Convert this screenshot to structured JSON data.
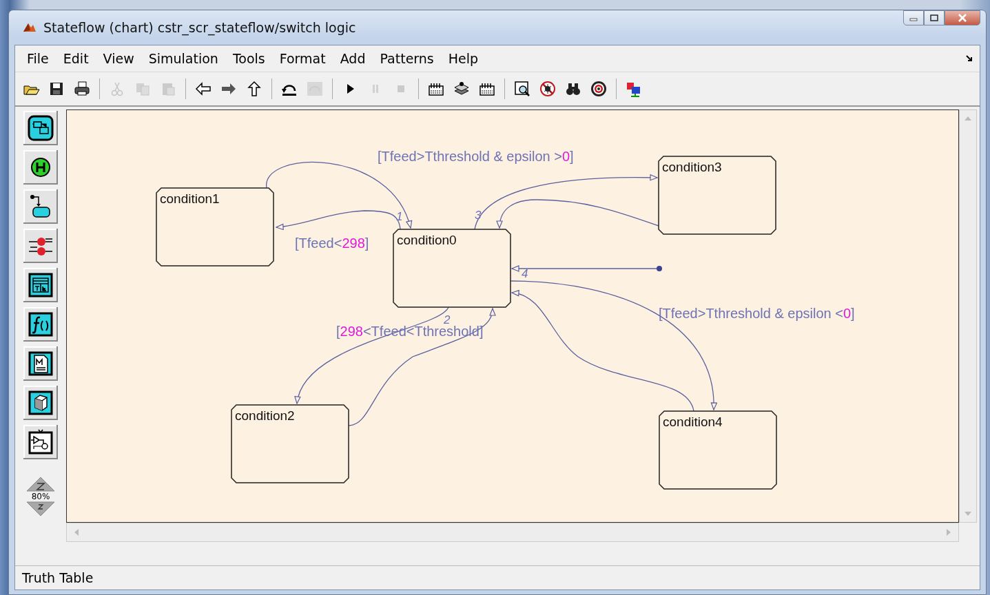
{
  "window": {
    "title": "Stateflow (chart) cstr_scr_stateflow/switch logic"
  },
  "menu": [
    "File",
    "Edit",
    "View",
    "Simulation",
    "Tools",
    "Format",
    "Add",
    "Patterns",
    "Help"
  ],
  "toolbar": [
    {
      "kind": "open",
      "disabled": false
    },
    {
      "kind": "save",
      "disabled": false
    },
    {
      "kind": "print",
      "disabled": false
    },
    {
      "kind": "separator"
    },
    {
      "kind": "cut",
      "disabled": true
    },
    {
      "kind": "copy",
      "disabled": true
    },
    {
      "kind": "paste",
      "disabled": true
    },
    {
      "kind": "separator"
    },
    {
      "kind": "back",
      "disabled": false
    },
    {
      "kind": "forward",
      "disabled": false
    },
    {
      "kind": "up",
      "disabled": false
    },
    {
      "kind": "separator"
    },
    {
      "kind": "undo",
      "disabled": false
    },
    {
      "kind": "redo",
      "disabled": true
    },
    {
      "kind": "separator"
    },
    {
      "kind": "play",
      "disabled": false
    },
    {
      "kind": "pause",
      "disabled": true
    },
    {
      "kind": "stop",
      "disabled": true
    },
    {
      "kind": "separator"
    },
    {
      "kind": "build",
      "disabled": false
    },
    {
      "kind": "stack",
      "disabled": false
    },
    {
      "kind": "rebuild",
      "disabled": false
    },
    {
      "kind": "separator"
    },
    {
      "kind": "explore",
      "disabled": false
    },
    {
      "kind": "debug",
      "disabled": false
    },
    {
      "kind": "find",
      "disabled": false
    },
    {
      "kind": "target",
      "disabled": false
    },
    {
      "kind": "separator"
    },
    {
      "kind": "model",
      "disabled": false
    }
  ],
  "palette": [
    {
      "kind": "state"
    },
    {
      "kind": "history"
    },
    {
      "kind": "default"
    },
    {
      "kind": "junction"
    },
    {
      "kind": "truthtable"
    },
    {
      "kind": "function"
    },
    {
      "kind": "mfile"
    },
    {
      "kind": "box"
    },
    {
      "kind": "simulink"
    }
  ],
  "zoom": "80%",
  "chart": {
    "states": [
      {
        "name": "condition1"
      },
      {
        "name": "condition0"
      },
      {
        "name": "condition3"
      },
      {
        "name": "condition2"
      },
      {
        "name": "condition4"
      }
    ],
    "order_numbers": [
      "1",
      "3",
      "4",
      "2"
    ],
    "guards": [
      {
        "parts": [
          {
            "text": "[Tfeed>Tthreshold & epsilon >",
            "kind": "expression"
          },
          {
            "text": "0",
            "kind": "constant"
          },
          {
            "text": "]",
            "kind": "expression"
          }
        ]
      },
      {
        "parts": [
          {
            "text": "[Tfeed<",
            "kind": "expression"
          },
          {
            "text": "298",
            "kind": "constant"
          },
          {
            "text": "]",
            "kind": "expression"
          }
        ]
      },
      {
        "parts": [
          {
            "text": "[",
            "kind": "expression"
          },
          {
            "text": "298",
            "kind": "constant"
          },
          {
            "text": "<Tfeed<Tthreshold]",
            "kind": "expression"
          }
        ]
      },
      {
        "parts": [
          {
            "text": "[Tfeed>Tthreshold & epsilon <",
            "kind": "expression"
          },
          {
            "text": "0",
            "kind": "constant"
          },
          {
            "text": "]",
            "kind": "expression"
          }
        ]
      }
    ]
  },
  "status_bar": "Truth Table"
}
